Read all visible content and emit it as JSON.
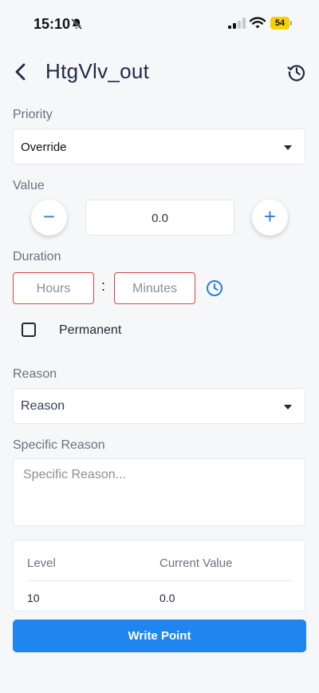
{
  "status_bar": {
    "time": "15:10",
    "battery": "54",
    "icons": [
      "bell-off-icon",
      "signal-icon",
      "wifi-icon",
      "battery-icon"
    ]
  },
  "header": {
    "title": "HtgVlv_out",
    "icons": [
      "back-chevron-icon",
      "history-icon"
    ]
  },
  "priority": {
    "label": "Priority",
    "selected": "Override"
  },
  "value": {
    "label": "Value",
    "current": "0.0",
    "decrement_symbol": "−",
    "increment_symbol": "+"
  },
  "duration": {
    "label": "Duration",
    "hours_placeholder": "Hours",
    "separator": ":",
    "minutes_placeholder": "Minutes"
  },
  "permanent": {
    "label": "Permanent",
    "checked": false
  },
  "reason": {
    "label": "Reason",
    "selected": "Reason"
  },
  "specific_reason": {
    "label": "Specific Reason",
    "placeholder": "Specific Reason..."
  },
  "levels_table": {
    "columns": [
      "Level",
      "Current Value"
    ],
    "rows": [
      [
        "10",
        "0.0"
      ]
    ]
  },
  "actions": {
    "write_label": "Write Point"
  },
  "colors": {
    "accent": "#1f86f0",
    "error_border": "#d64545",
    "title": "#1e2b45",
    "battery": "#f4d100"
  }
}
